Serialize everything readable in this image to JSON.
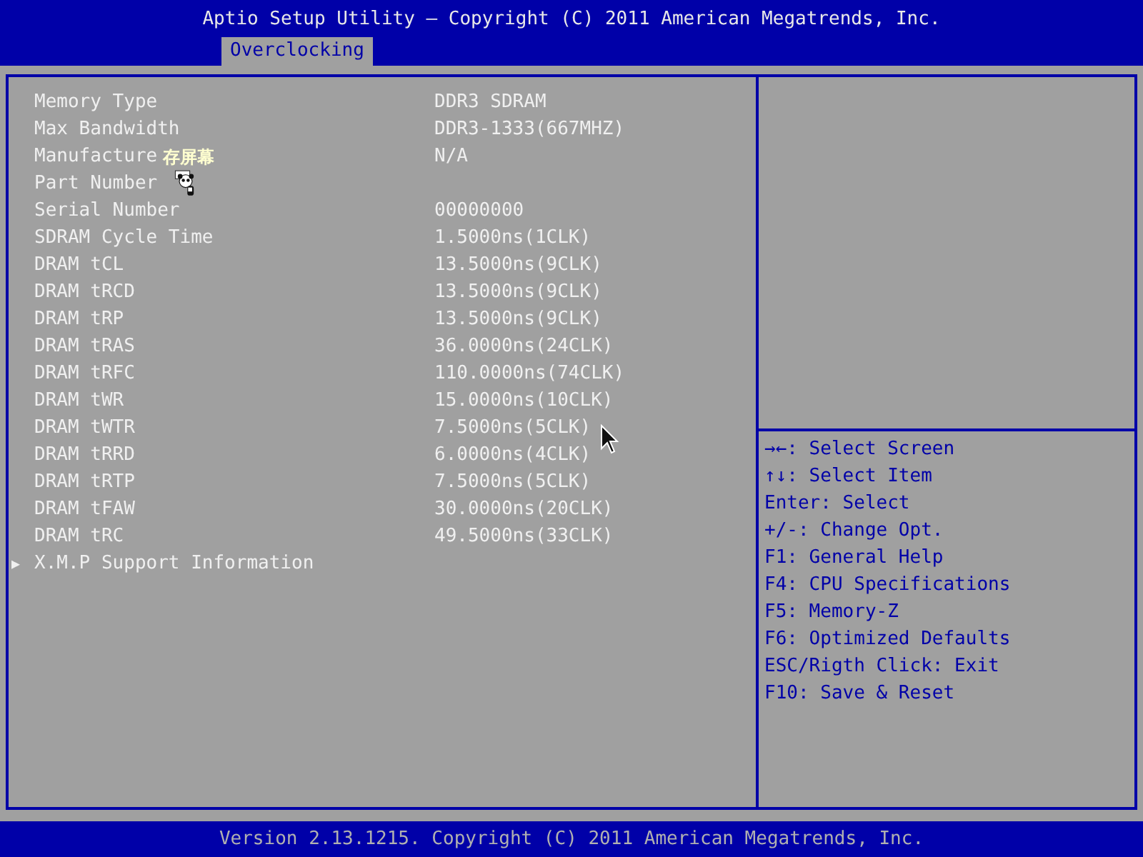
{
  "title": "Aptio Setup Utility – Copyright (C) 2011 American Megatrends, Inc.",
  "tabs": [
    {
      "label": "Overclocking",
      "selected": true
    }
  ],
  "items": [
    {
      "kind": "info",
      "label": "Memory Type",
      "value": "DDR3 SDRAM"
    },
    {
      "kind": "info",
      "label": "Max Bandwidth",
      "value": "DDR3-1333(667MHZ)"
    },
    {
      "kind": "info",
      "label": "Manufacture",
      "value": "N/A",
      "overlay": "存屏幕"
    },
    {
      "kind": "info",
      "label": "Part Number"
    },
    {
      "kind": "info",
      "label": "Serial Number",
      "value": "00000000"
    },
    {
      "kind": "info",
      "label": "SDRAM Cycle Time",
      "value": "1.5000ns(1CLK)"
    },
    {
      "kind": "info",
      "label": "DRAM tCL",
      "value": "13.5000ns(9CLK)"
    },
    {
      "kind": "info",
      "label": "DRAM tRCD",
      "value": "13.5000ns(9CLK)"
    },
    {
      "kind": "info",
      "label": "DRAM tRP",
      "value": "13.5000ns(9CLK)"
    },
    {
      "kind": "info",
      "label": "DRAM tRAS",
      "value": "36.0000ns(24CLK)"
    },
    {
      "kind": "info",
      "label": "DRAM tRFC",
      "value": "110.0000ns(74CLK)"
    },
    {
      "kind": "info",
      "label": "DRAM tWR",
      "value": "15.0000ns(10CLK)"
    },
    {
      "kind": "info",
      "label": "DRAM tWTR",
      "value": "7.5000ns(5CLK)"
    },
    {
      "kind": "info",
      "label": "DRAM tRRD",
      "value": "6.0000ns(4CLK)"
    },
    {
      "kind": "info",
      "label": "DRAM tRTP",
      "value": "7.5000ns(5CLK)"
    },
    {
      "kind": "info",
      "label": "DRAM tFAW",
      "value": "30.0000ns(20CLK)"
    },
    {
      "kind": "info",
      "label": "DRAM tRC",
      "value": "49.5000ns(33CLK)"
    },
    {
      "kind": "submenu",
      "marker": "▶",
      "label": "X.M.P Support Information"
    }
  ],
  "help": [
    "→←: Select Screen",
    "↑↓: Select Item",
    "Enter: Select",
    "+/-: Change Opt.",
    "F1: General Help",
    "F4: CPU Specifications",
    "F5: Memory-Z",
    "F6: Optimized Defaults",
    "ESC/Rigth Click: Exit",
    "F10: Save & Reset"
  ],
  "footer": "Version 2.13.1215. Copyright (C) 2011 American Megatrends, Inc."
}
